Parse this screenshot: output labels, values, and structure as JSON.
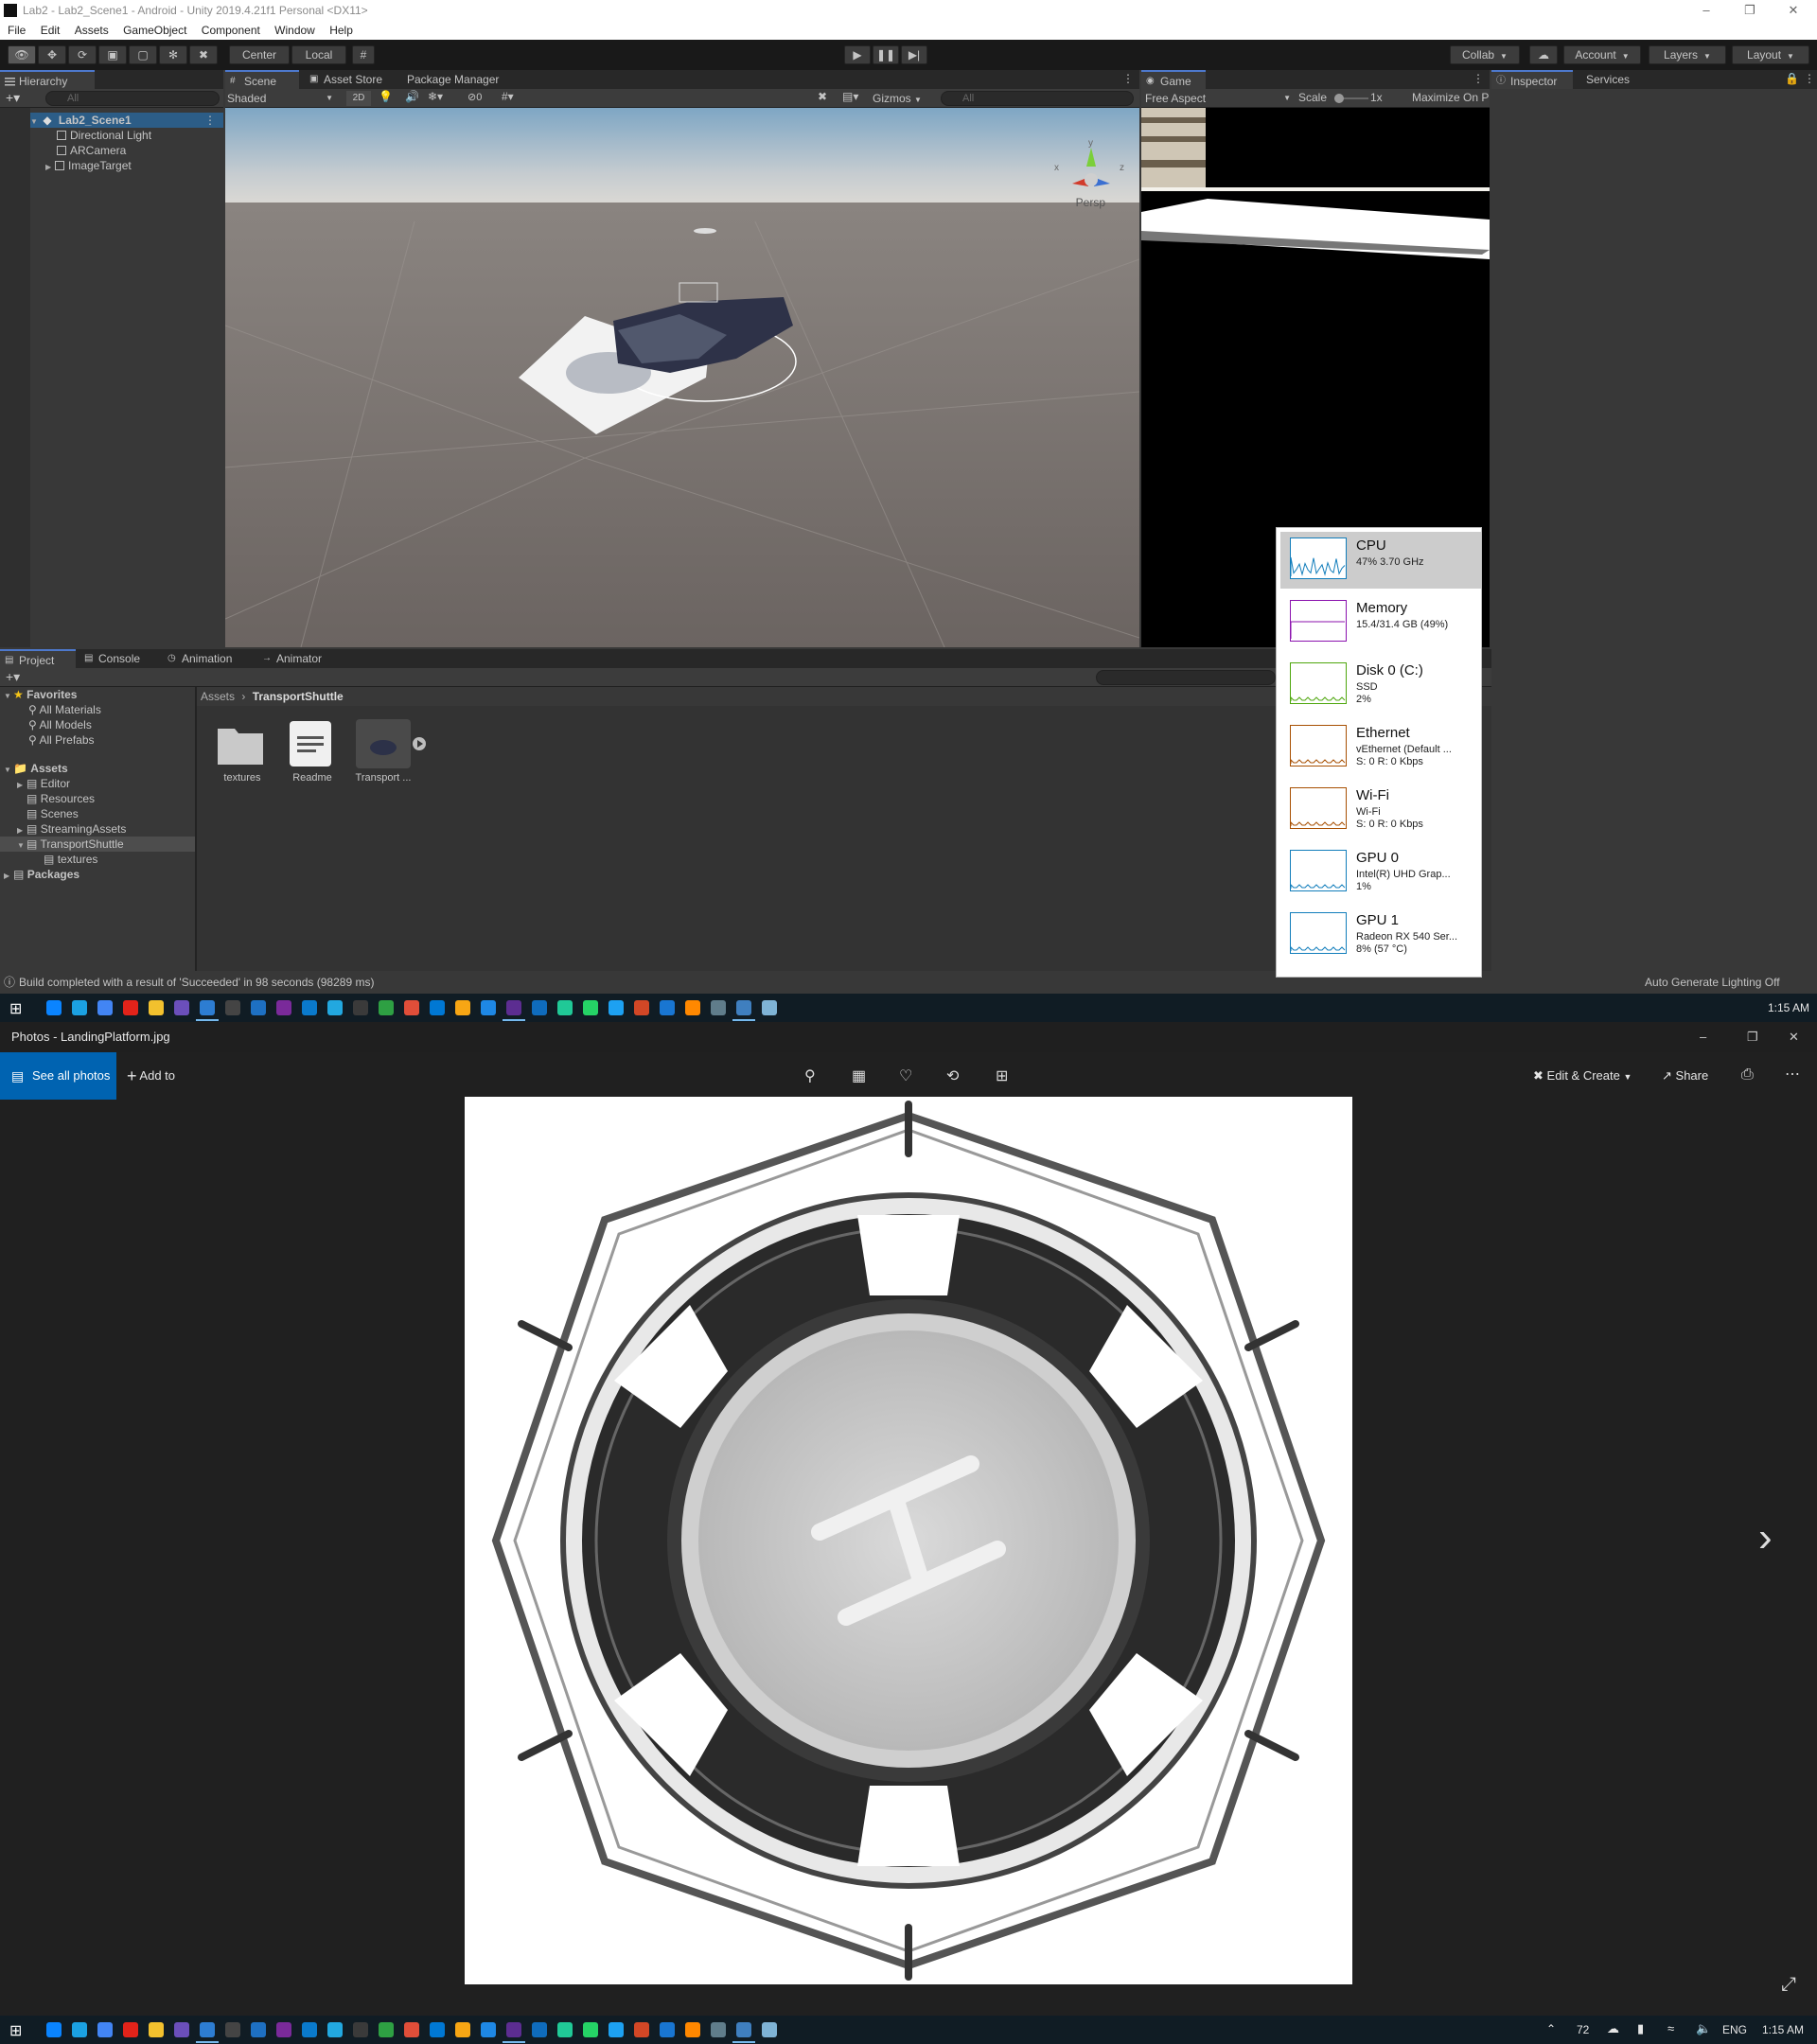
{
  "unity": {
    "title": "Lab2 - Lab2_Scene1 - Android - Unity 2019.4.21f1 Personal <DX11>",
    "menu": [
      "File",
      "Edit",
      "Assets",
      "GameObject",
      "Component",
      "Window",
      "Help"
    ],
    "toolbar": {
      "pivot": "Center",
      "space": "Local",
      "collab": "Collab",
      "account": "Account",
      "layers": "Layers",
      "layout": "Layout"
    },
    "hierarchy": {
      "tab": "Hierarchy",
      "search_placeholder": "All",
      "scene": "Lab2_Scene1",
      "items": [
        "Directional Light",
        "ARCamera",
        "ImageTarget"
      ]
    },
    "scene": {
      "tabs": [
        "Scene",
        "Asset Store",
        "Package Manager"
      ],
      "shading": "Shaded",
      "mode_2d": "2D",
      "hidden_count": "0",
      "gizmos": "Gizmos",
      "search_placeholder": "All",
      "persp": "Persp",
      "axis_x": "x",
      "axis_y": "y",
      "axis_z": "z"
    },
    "game": {
      "tab": "Game",
      "aspect": "Free Aspect",
      "scale_label": "Scale",
      "scale_value": "1x",
      "maximize": "Maximize On P"
    },
    "inspector": {
      "tabs": [
        "Inspector",
        "Services"
      ]
    },
    "project": {
      "tabs": [
        "Project",
        "Console",
        "Animation",
        "Animator"
      ],
      "favorites_label": "Favorites",
      "favorites": [
        "All Materials",
        "All Models",
        "All Prefabs"
      ],
      "assets_label": "Assets",
      "assets_tree": [
        "Editor",
        "Resources",
        "Scenes",
        "StreamingAssets",
        "TransportShuttle",
        "textures"
      ],
      "packages_label": "Packages",
      "breadcrumb_root": "Assets",
      "breadcrumb_current": "TransportShuttle",
      "grid": [
        "textures",
        "Readme",
        "Transport ..."
      ]
    },
    "status": {
      "message": "Build completed with a result of 'Succeeded' in 98 seconds (98289 ms)",
      "right": "Auto Generate Lighting Off"
    }
  },
  "taskmanager": {
    "items": [
      {
        "name": "CPU",
        "line1": "47%  3.70 GHz",
        "line2": "",
        "color": "#117dbb"
      },
      {
        "name": "Memory",
        "line1": "15.4/31.4 GB (49%)",
        "line2": "",
        "color": "#8b12ae"
      },
      {
        "name": "Disk 0 (C:)",
        "line1": "SSD",
        "line2": "2%",
        "color": "#4da60c"
      },
      {
        "name": "Ethernet",
        "line1": "vEthernet (Default ...",
        "line2": "S: 0  R: 0 Kbps",
        "color": "#a74f01"
      },
      {
        "name": "Wi-Fi",
        "line1": "Wi-Fi",
        "line2": "S: 0  R: 0 Kbps",
        "color": "#a74f01"
      },
      {
        "name": "GPU 0",
        "line1": "Intel(R) UHD Grap...",
        "line2": "1%",
        "color": "#117dbb"
      },
      {
        "name": "GPU 1",
        "line1": "Radeon RX 540 Ser...",
        "line2": "8% (57 °C)",
        "color": "#117dbb"
      }
    ]
  },
  "taskbar": {
    "time": "1:15 AM",
    "weather": "72",
    "language": "ENG"
  },
  "photos": {
    "title": "Photos - LandingPlatform.jpg",
    "see_all": "See all photos",
    "add_to": "Add to",
    "edit_create": "Edit & Create",
    "share": "Share"
  },
  "colors": {
    "unity_bg": "#383838",
    "selection": "#2c5d87",
    "accent_blue": "#4d78cc",
    "photos_accent": "#0063b1"
  }
}
